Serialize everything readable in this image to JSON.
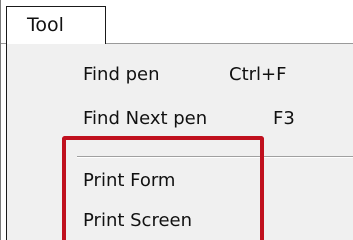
{
  "menubar": {
    "title": "Tool"
  },
  "menu": {
    "items": [
      {
        "label": "Find pen",
        "shortcut": "Ctrl+F"
      },
      {
        "label": "Find Next pen",
        "shortcut": "F3"
      },
      {
        "label": "Print Form",
        "shortcut": ""
      },
      {
        "label": "Print Screen",
        "shortcut": ""
      }
    ]
  },
  "colors": {
    "highlight_border": "#c0101e",
    "menu_background": "#f0f0f0"
  }
}
